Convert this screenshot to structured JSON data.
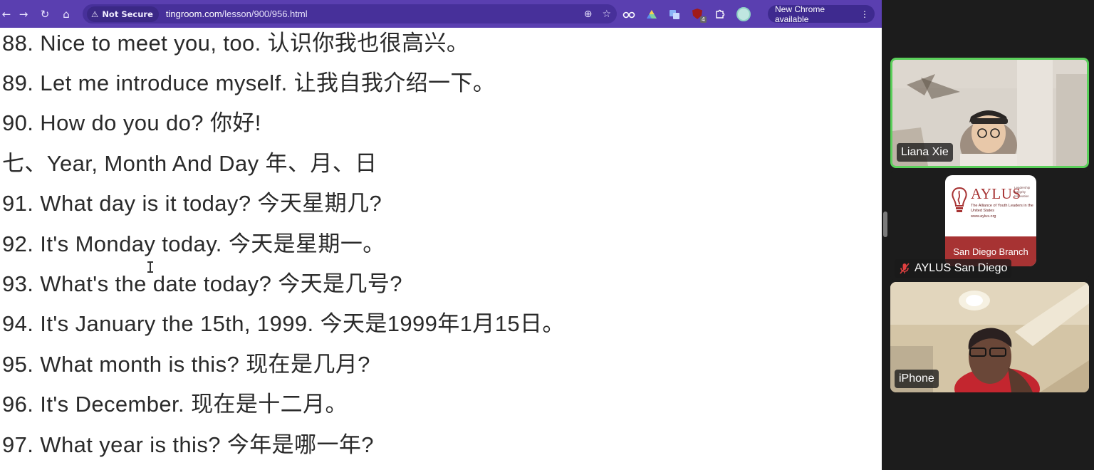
{
  "browser": {
    "security_label": "Not Secure",
    "url_domain": "tingroom.com",
    "url_path": "/lesson/900/956.html",
    "update_label": "New Chrome available",
    "accent_color": "#5a3fb0"
  },
  "lesson_lines": [
    "88. Nice to meet you, too. 认识你我也很高兴。",
    "89. Let me introduce myself. 让我自我介绍一下。",
    "90. How do you do? 你好!",
    "七、Year, Month And Day 年、月、日",
    "91. What day is it today? 今天星期几?",
    "92. It's Monday today. 今天是星期一。",
    "93. What's the date today? 今天是几号?",
    "94. It's January the 15th, 1999. 今天是1999年1月15日。",
    "95. What month is this? 现在是几月?",
    "96. It's December. 现在是十二月。",
    "97. What year is this? 今年是哪一年?"
  ],
  "participants": [
    {
      "name": "Liana Xie",
      "active_speaker": true,
      "muted": false
    },
    {
      "name": "AYLUS San Diego",
      "active_speaker": false,
      "muted": true
    },
    {
      "name": "iPhone",
      "active_speaker": false,
      "muted": false
    }
  ],
  "logo": {
    "word": "AYLUS",
    "tagline": "The Alliance of Youth Leaders in the United States",
    "website": "www.aylus.org",
    "values": "Leadership Integrity Innovation",
    "branch": "San Diego Branch",
    "brand_color": "#a73333"
  },
  "extension_badge": "4"
}
